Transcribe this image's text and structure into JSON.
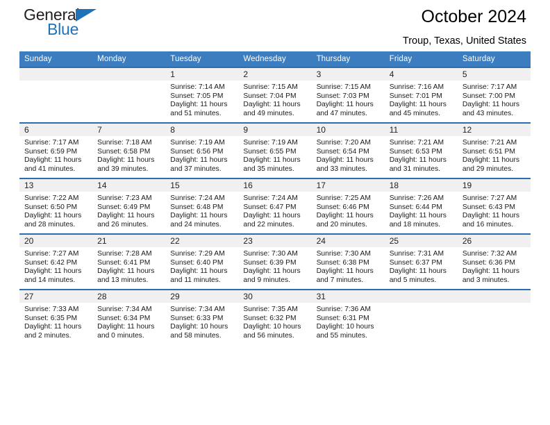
{
  "brand": {
    "name_part1": "General",
    "name_part2": "Blue",
    "triangle_color": "#1f72b8",
    "text_color": "#231f20"
  },
  "header": {
    "title": "October 2024",
    "subtitle": "Troup, Texas, United States"
  },
  "theme": {
    "header_row_bg": "#3b7dbf",
    "row_border": "#2a6eb0",
    "daynum_band_bg": "#f0f0f0"
  },
  "weekdays": [
    "Sunday",
    "Monday",
    "Tuesday",
    "Wednesday",
    "Thursday",
    "Friday",
    "Saturday"
  ],
  "weeks": [
    [
      {
        "day": "",
        "sunrise": "",
        "sunset": "",
        "daylight": ""
      },
      {
        "day": "",
        "sunrise": "",
        "sunset": "",
        "daylight": ""
      },
      {
        "day": "1",
        "sunrise": "Sunrise: 7:14 AM",
        "sunset": "Sunset: 7:05 PM",
        "daylight": "Daylight: 11 hours and 51 minutes."
      },
      {
        "day": "2",
        "sunrise": "Sunrise: 7:15 AM",
        "sunset": "Sunset: 7:04 PM",
        "daylight": "Daylight: 11 hours and 49 minutes."
      },
      {
        "day": "3",
        "sunrise": "Sunrise: 7:15 AM",
        "sunset": "Sunset: 7:03 PM",
        "daylight": "Daylight: 11 hours and 47 minutes."
      },
      {
        "day": "4",
        "sunrise": "Sunrise: 7:16 AM",
        "sunset": "Sunset: 7:01 PM",
        "daylight": "Daylight: 11 hours and 45 minutes."
      },
      {
        "day": "5",
        "sunrise": "Sunrise: 7:17 AM",
        "sunset": "Sunset: 7:00 PM",
        "daylight": "Daylight: 11 hours and 43 minutes."
      }
    ],
    [
      {
        "day": "6",
        "sunrise": "Sunrise: 7:17 AM",
        "sunset": "Sunset: 6:59 PM",
        "daylight": "Daylight: 11 hours and 41 minutes."
      },
      {
        "day": "7",
        "sunrise": "Sunrise: 7:18 AM",
        "sunset": "Sunset: 6:58 PM",
        "daylight": "Daylight: 11 hours and 39 minutes."
      },
      {
        "day": "8",
        "sunrise": "Sunrise: 7:19 AM",
        "sunset": "Sunset: 6:56 PM",
        "daylight": "Daylight: 11 hours and 37 minutes."
      },
      {
        "day": "9",
        "sunrise": "Sunrise: 7:19 AM",
        "sunset": "Sunset: 6:55 PM",
        "daylight": "Daylight: 11 hours and 35 minutes."
      },
      {
        "day": "10",
        "sunrise": "Sunrise: 7:20 AM",
        "sunset": "Sunset: 6:54 PM",
        "daylight": "Daylight: 11 hours and 33 minutes."
      },
      {
        "day": "11",
        "sunrise": "Sunrise: 7:21 AM",
        "sunset": "Sunset: 6:53 PM",
        "daylight": "Daylight: 11 hours and 31 minutes."
      },
      {
        "day": "12",
        "sunrise": "Sunrise: 7:21 AM",
        "sunset": "Sunset: 6:51 PM",
        "daylight": "Daylight: 11 hours and 29 minutes."
      }
    ],
    [
      {
        "day": "13",
        "sunrise": "Sunrise: 7:22 AM",
        "sunset": "Sunset: 6:50 PM",
        "daylight": "Daylight: 11 hours and 28 minutes."
      },
      {
        "day": "14",
        "sunrise": "Sunrise: 7:23 AM",
        "sunset": "Sunset: 6:49 PM",
        "daylight": "Daylight: 11 hours and 26 minutes."
      },
      {
        "day": "15",
        "sunrise": "Sunrise: 7:24 AM",
        "sunset": "Sunset: 6:48 PM",
        "daylight": "Daylight: 11 hours and 24 minutes."
      },
      {
        "day": "16",
        "sunrise": "Sunrise: 7:24 AM",
        "sunset": "Sunset: 6:47 PM",
        "daylight": "Daylight: 11 hours and 22 minutes."
      },
      {
        "day": "17",
        "sunrise": "Sunrise: 7:25 AM",
        "sunset": "Sunset: 6:46 PM",
        "daylight": "Daylight: 11 hours and 20 minutes."
      },
      {
        "day": "18",
        "sunrise": "Sunrise: 7:26 AM",
        "sunset": "Sunset: 6:44 PM",
        "daylight": "Daylight: 11 hours and 18 minutes."
      },
      {
        "day": "19",
        "sunrise": "Sunrise: 7:27 AM",
        "sunset": "Sunset: 6:43 PM",
        "daylight": "Daylight: 11 hours and 16 minutes."
      }
    ],
    [
      {
        "day": "20",
        "sunrise": "Sunrise: 7:27 AM",
        "sunset": "Sunset: 6:42 PM",
        "daylight": "Daylight: 11 hours and 14 minutes."
      },
      {
        "day": "21",
        "sunrise": "Sunrise: 7:28 AM",
        "sunset": "Sunset: 6:41 PM",
        "daylight": "Daylight: 11 hours and 13 minutes."
      },
      {
        "day": "22",
        "sunrise": "Sunrise: 7:29 AM",
        "sunset": "Sunset: 6:40 PM",
        "daylight": "Daylight: 11 hours and 11 minutes."
      },
      {
        "day": "23",
        "sunrise": "Sunrise: 7:30 AM",
        "sunset": "Sunset: 6:39 PM",
        "daylight": "Daylight: 11 hours and 9 minutes."
      },
      {
        "day": "24",
        "sunrise": "Sunrise: 7:30 AM",
        "sunset": "Sunset: 6:38 PM",
        "daylight": "Daylight: 11 hours and 7 minutes."
      },
      {
        "day": "25",
        "sunrise": "Sunrise: 7:31 AM",
        "sunset": "Sunset: 6:37 PM",
        "daylight": "Daylight: 11 hours and 5 minutes."
      },
      {
        "day": "26",
        "sunrise": "Sunrise: 7:32 AM",
        "sunset": "Sunset: 6:36 PM",
        "daylight": "Daylight: 11 hours and 3 minutes."
      }
    ],
    [
      {
        "day": "27",
        "sunrise": "Sunrise: 7:33 AM",
        "sunset": "Sunset: 6:35 PM",
        "daylight": "Daylight: 11 hours and 2 minutes."
      },
      {
        "day": "28",
        "sunrise": "Sunrise: 7:34 AM",
        "sunset": "Sunset: 6:34 PM",
        "daylight": "Daylight: 11 hours and 0 minutes."
      },
      {
        "day": "29",
        "sunrise": "Sunrise: 7:34 AM",
        "sunset": "Sunset: 6:33 PM",
        "daylight": "Daylight: 10 hours and 58 minutes."
      },
      {
        "day": "30",
        "sunrise": "Sunrise: 7:35 AM",
        "sunset": "Sunset: 6:32 PM",
        "daylight": "Daylight: 10 hours and 56 minutes."
      },
      {
        "day": "31",
        "sunrise": "Sunrise: 7:36 AM",
        "sunset": "Sunset: 6:31 PM",
        "daylight": "Daylight: 10 hours and 55 minutes."
      },
      {
        "day": "",
        "sunrise": "",
        "sunset": "",
        "daylight": ""
      },
      {
        "day": "",
        "sunrise": "",
        "sunset": "",
        "daylight": ""
      }
    ]
  ]
}
